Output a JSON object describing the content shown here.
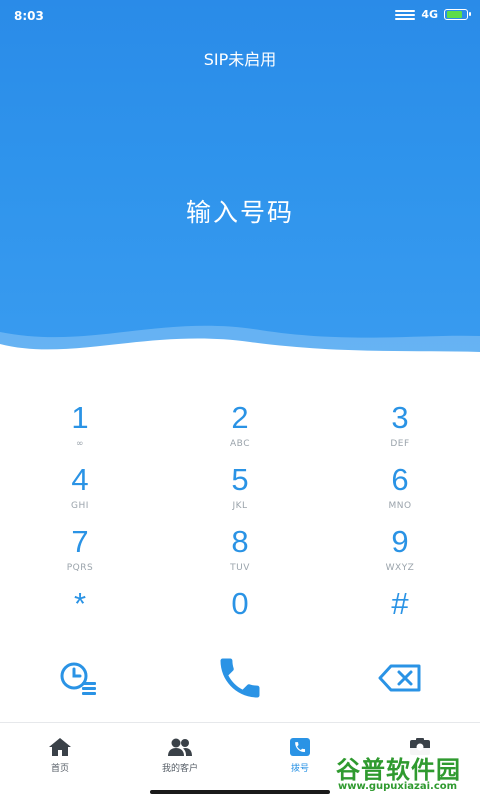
{
  "status_bar": {
    "time": "8:03",
    "network": "4G"
  },
  "header": {
    "sip_status": "SIP未启用",
    "number_placeholder": "输入号码"
  },
  "keypad": {
    "keys": [
      {
        "digit": "1",
        "letters": "∞"
      },
      {
        "digit": "2",
        "letters": "ABC"
      },
      {
        "digit": "3",
        "letters": "DEF"
      },
      {
        "digit": "4",
        "letters": "GHI"
      },
      {
        "digit": "5",
        "letters": "JKL"
      },
      {
        "digit": "6",
        "letters": "MNO"
      },
      {
        "digit": "7",
        "letters": "PQRS"
      },
      {
        "digit": "8",
        "letters": "TUV"
      },
      {
        "digit": "9",
        "letters": "WXYZ"
      },
      {
        "digit": "*",
        "letters": ""
      },
      {
        "digit": "0",
        "letters": ""
      },
      {
        "digit": "#",
        "letters": ""
      }
    ]
  },
  "actions": {
    "history_icon": "clock-list-icon",
    "call_icon": "phone-icon",
    "delete_icon": "backspace-icon"
  },
  "tabs": [
    {
      "label": "首页",
      "icon": "home-icon"
    },
    {
      "label": "我的客户",
      "icon": "contacts-icon"
    },
    {
      "label": "拨号",
      "icon": "dialpad-icon",
      "active": true
    },
    {
      "label": "",
      "icon": "profile-icon"
    }
  ],
  "watermark": {
    "title": "谷普软件园",
    "url": "www.gupuxiazai.com"
  },
  "colors": {
    "header_blue": "#2f94ec",
    "accent_blue": "#2a93e5"
  }
}
